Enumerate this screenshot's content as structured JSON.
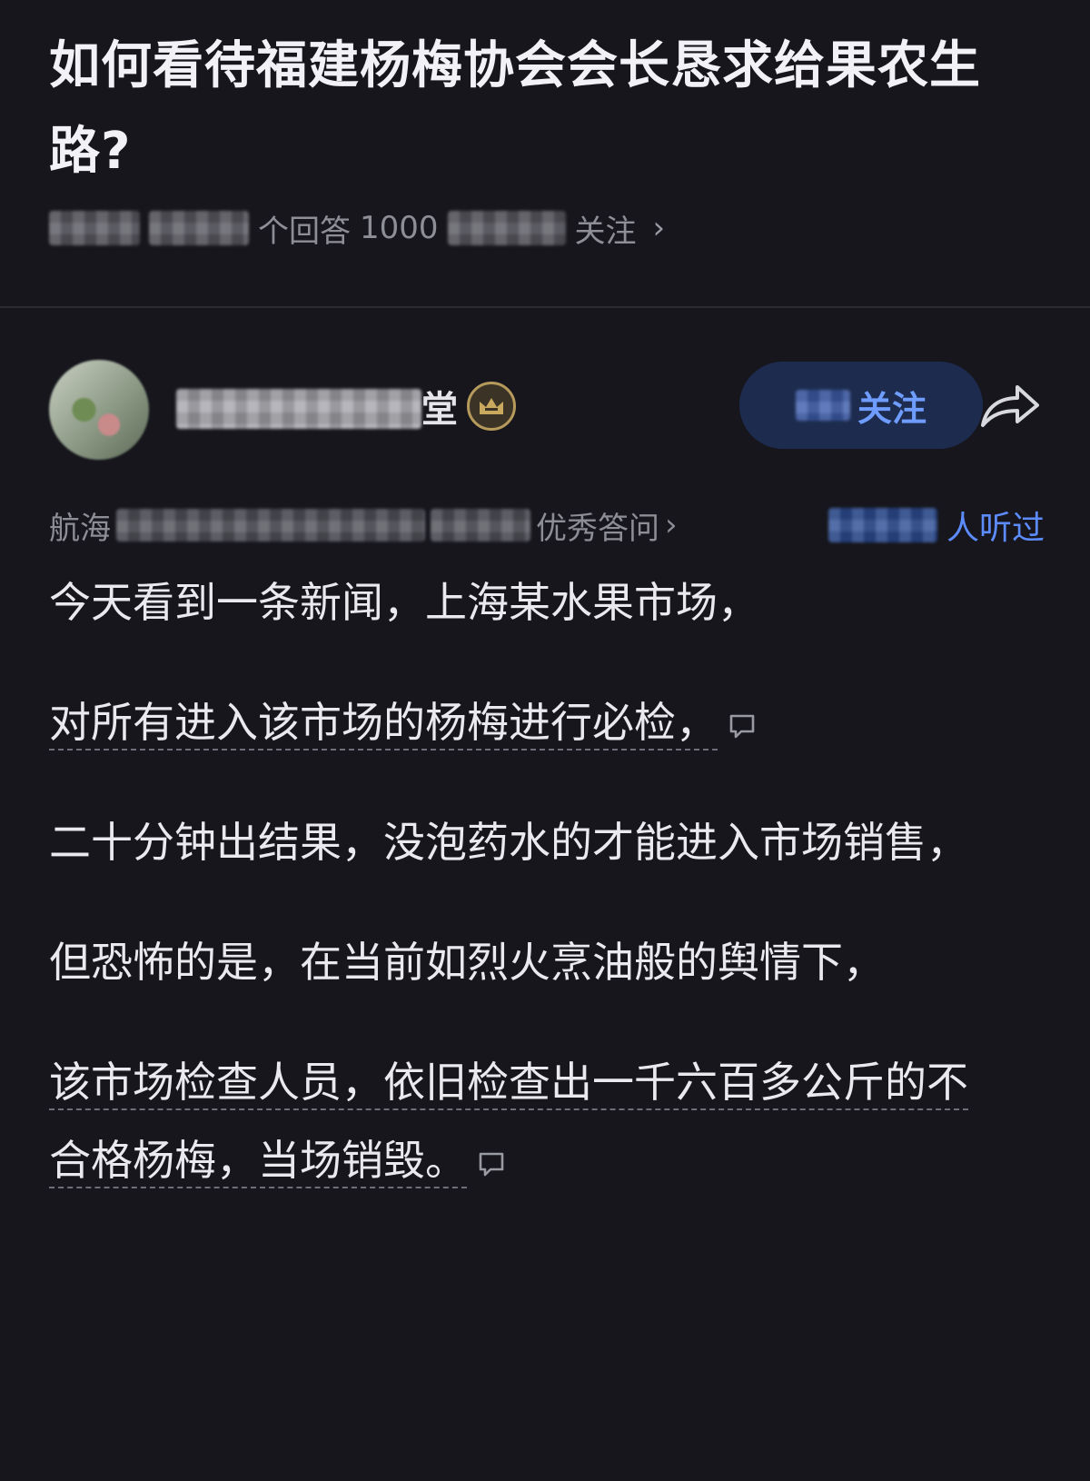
{
  "question": {
    "title": "如何看待福建杨梅协会会长恳求给果农生路?",
    "meta_visible_1": "个回答",
    "meta_visible_2": "1000",
    "meta_visible_3": "关注"
  },
  "author": {
    "name_visible_tail": "堂"
  },
  "follow_button": {
    "label_visible": "关注"
  },
  "answer_meta": {
    "prefix": "航海",
    "middle_visible": "优秀答问",
    "listened_label": "人听过"
  },
  "answer": {
    "paragraphs": [
      "今天看到一条新闻，上海某水果市场，",
      "对所有进入该市场的杨梅进行必检，",
      "二十分钟出结果，没泡药水的才能进入市场销售，",
      "但恐怖的是，在当前如烈火烹油般的舆情下，",
      "该市场检查人员，依旧检查出一千六百多公斤的不合格杨梅，当场销毁。"
    ]
  },
  "icons": {
    "share": "share-arrow-icon",
    "comment": "comment-bubble-icon",
    "badge": "crown-badge-icon",
    "chevron": "chevron-right-icon"
  },
  "colors": {
    "background": "#16161c",
    "accent": "#5d8cff",
    "follow_bg": "#1d2c4e"
  }
}
